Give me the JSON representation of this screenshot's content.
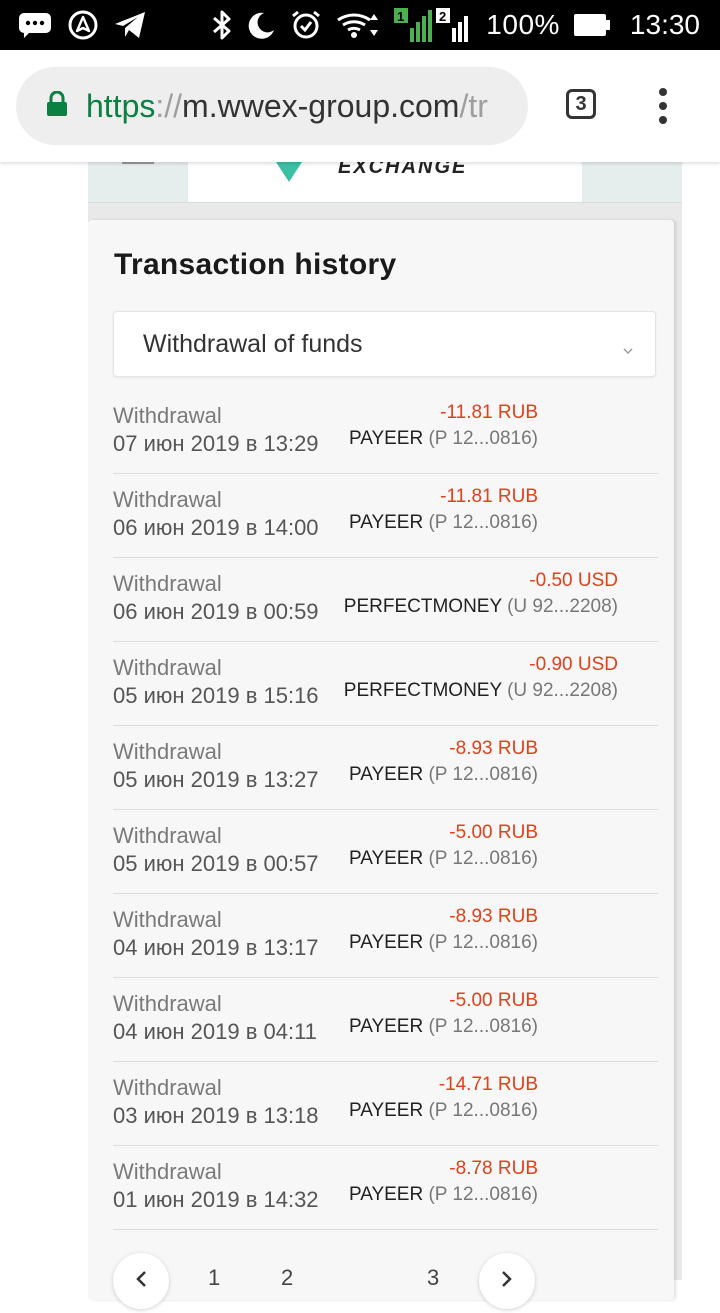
{
  "status_bar": {
    "battery": "100%",
    "time": "13:30",
    "sim1": "1",
    "sim2": "2",
    "icons": [
      "chat-icon",
      "nav-icon",
      "telegram-icon",
      "bluetooth-icon",
      "moon-icon",
      "alarm-icon",
      "wifi-icon",
      "signal-icon",
      "battery-icon"
    ]
  },
  "browser": {
    "url_scheme": "https",
    "url_sep": "://",
    "url_host": "m.wwex-group.com",
    "url_rest": "/tr",
    "tab_count": "3"
  },
  "site": {
    "logo_text": "EXCHANGE"
  },
  "card": {
    "title": "Transaction history",
    "filter": {
      "selected": "Withdrawal of funds"
    }
  },
  "transactions": [
    {
      "type": "Withdrawal",
      "date": "07 июн 2019 в 13:29",
      "amount": "-11.81 RUB",
      "system": "PAYEER",
      "account": "(P 12...0816)"
    },
    {
      "type": "Withdrawal",
      "date": "06 июн 2019 в 14:00",
      "amount": "-11.81 RUB",
      "system": "PAYEER",
      "account": "(P 12...0816)"
    },
    {
      "type": "Withdrawal",
      "date": "06 июн 2019 в 00:59",
      "amount": "-0.50 USD",
      "system": "PERFECTMONEY",
      "account": "(U 92...2208)"
    },
    {
      "type": "Withdrawal",
      "date": "05 июн 2019 в 15:16",
      "amount": "-0.90 USD",
      "system": "PERFECTMONEY",
      "account": "(U 92...2208)"
    },
    {
      "type": "Withdrawal",
      "date": "05 июн 2019 в 13:27",
      "amount": "-8.93 RUB",
      "system": "PAYEER",
      "account": "(P 12...0816)"
    },
    {
      "type": "Withdrawal",
      "date": "05 июн 2019 в 00:57",
      "amount": "-5.00 RUB",
      "system": "PAYEER",
      "account": "(P 12...0816)"
    },
    {
      "type": "Withdrawal",
      "date": "04 июн 2019 в 13:17",
      "amount": "-8.93 RUB",
      "system": "PAYEER",
      "account": "(P 12...0816)"
    },
    {
      "type": "Withdrawal",
      "date": "04 июн 2019 в 04:11",
      "amount": "-5.00 RUB",
      "system": "PAYEER",
      "account": "(P 12...0816)"
    },
    {
      "type": "Withdrawal",
      "date": "03 июн 2019 в 13:18",
      "amount": "-14.71 RUB",
      "system": "PAYEER",
      "account": "(P 12...0816)"
    },
    {
      "type": "Withdrawal",
      "date": "01 июн 2019 в 14:32",
      "amount": "-8.78 RUB",
      "system": "PAYEER",
      "account": "(P 12...0816)"
    }
  ],
  "pagination": {
    "pages": [
      "1",
      "2",
      "3"
    ]
  },
  "colors": {
    "amount": "#e0401a",
    "secure": "#0b8043",
    "accent": "#3dbfa5"
  }
}
